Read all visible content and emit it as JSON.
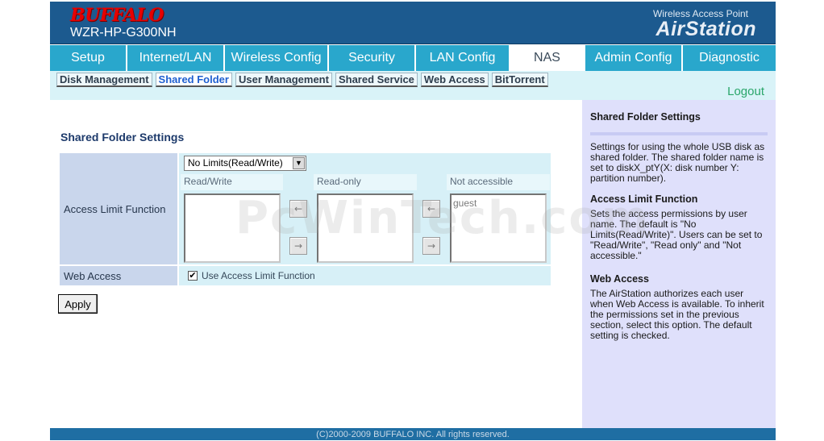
{
  "header": {
    "brand": "BUFFALO",
    "model": "WZR-HP-G300NH",
    "product_sub": "Wireless Access Point",
    "product_name": "AirStation"
  },
  "nav": {
    "tabs": [
      "Setup",
      "Internet/LAN",
      "Wireless Config",
      "Security",
      "LAN Config",
      "NAS",
      "Admin Config",
      "Diagnostic"
    ],
    "active": "NAS"
  },
  "subnav": {
    "tabs": [
      "Disk Management",
      "Shared Folder",
      "User Management",
      "Shared Service",
      "Web Access",
      "BitTorrent"
    ],
    "active": "Shared Folder",
    "logout": "Logout"
  },
  "main": {
    "title": "Shared Folder Settings",
    "access_limit": {
      "label": "Access Limit Function",
      "select_value": "No Limits(Read/Write)",
      "columns": {
        "read_write": "Read/Write",
        "read_only": "Read-only",
        "not_accessible": "Not accessible"
      },
      "read_write_items": [],
      "read_only_items": [],
      "not_accessible_items": [
        "guest"
      ],
      "arrow_left": "←",
      "arrow_right": "→"
    },
    "web_access": {
      "label": "Web Access",
      "checkbox_label": "Use Access Limit Function",
      "checked": true,
      "check_mark": "✔"
    },
    "apply_label": "Apply"
  },
  "help": {
    "title": "Shared Folder Settings",
    "intro": "Settings for using the whole USB disk as shared folder. The shared folder name is set to diskX_ptY(X: disk number Y: partition number).",
    "access_head": "Access Limit Function",
    "access_text": "Sets the access permissions by user name. The default is \"No Limits(Read/Write)\". Users can be set to \"Read/Write\", \"Read only\" and \"Not accessible.\"",
    "web_head": "Web Access",
    "web_text": "The AirStation authorizes each user when Web Access is available. To inherit the permissions set in the previous section, select this option. The default setting is checked."
  },
  "footer": {
    "copyright": "(C)2000-2009 BUFFALO INC. All rights reserved."
  },
  "watermark": "PcWinTech.com",
  "colors": {
    "header_bg": "#1c5a8f",
    "nav_bg": "#29a7cc",
    "subnav_bg": "#d9f3f8",
    "label_cell": "#c9d6ec",
    "value_cell": "#d7f0f7",
    "help_bg": "#dfe0fb",
    "logout": "#2aa66a",
    "brand_red": "#e60000"
  }
}
